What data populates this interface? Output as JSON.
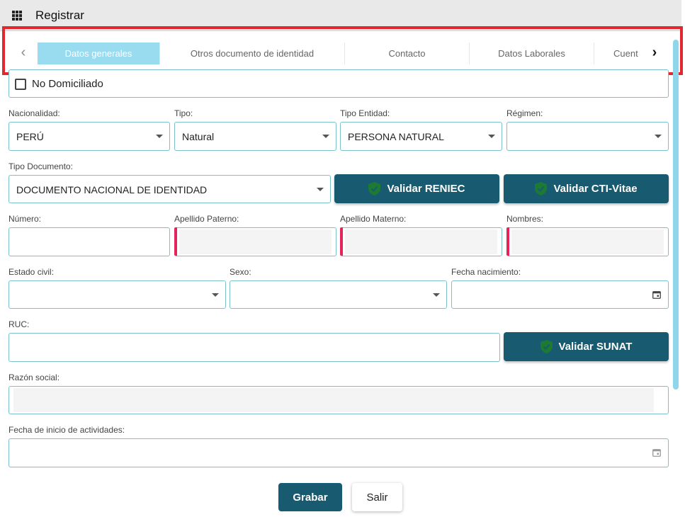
{
  "window": {
    "title": "Registrar",
    "menu_icon": "grid-menu-icon"
  },
  "tabs": [
    {
      "label": "Datos generales",
      "active": true
    },
    {
      "label": "Otros documento de identidad",
      "active": false
    },
    {
      "label": "Contacto",
      "active": false
    },
    {
      "label": "Datos Laborales",
      "active": false
    },
    {
      "label": "Cuent",
      "active": false
    }
  ],
  "nav": {
    "prev_symbol": "‹",
    "next_symbol": "›"
  },
  "checkbox": {
    "label": "No Domiciliado",
    "checked": false
  },
  "fields": {
    "nacionalidad": {
      "label": "Nacionalidad:",
      "value": "PERÚ"
    },
    "tipo": {
      "label": "Tipo:",
      "value": "Natural"
    },
    "tipo_entidad": {
      "label": "Tipo Entidad:",
      "value": "PERSONA NATURAL"
    },
    "regimen": {
      "label": "Régimen:",
      "value": ""
    },
    "tipo_documento": {
      "label": "Tipo Documento:",
      "value": "DOCUMENTO NACIONAL DE IDENTIDAD"
    },
    "numero": {
      "label": "Número:",
      "value": ""
    },
    "apellido_paterno": {
      "label": "Apellido Paterno:",
      "value": ""
    },
    "apellido_materno": {
      "label": "Apellido Materno:",
      "value": ""
    },
    "nombres": {
      "label": "Nombres:",
      "value": ""
    },
    "estado_civil": {
      "label": "Estado civil:",
      "value": ""
    },
    "sexo": {
      "label": "Sexo:",
      "value": ""
    },
    "fecha_nacimiento": {
      "label": "Fecha nacimiento:",
      "value": ""
    },
    "ruc": {
      "label": "RUC:",
      "value": ""
    },
    "razon_social": {
      "label": "Razón social:",
      "value": ""
    },
    "fecha_inicio": {
      "label": "Fecha de inicio de actividades:",
      "value": ""
    }
  },
  "buttons": {
    "validar_reniec": "Validar RENIEC",
    "validar_cti": "Validar CTI-Vitae",
    "validar_sunat": "Validar SUNAT",
    "grabar": "Grabar",
    "salir": "Salir"
  },
  "colors": {
    "primary": "#185a6f",
    "tab_active": "#99dbef",
    "highlight": "#e0282e",
    "required": "#e4245a",
    "shield": "#1c7a33"
  }
}
